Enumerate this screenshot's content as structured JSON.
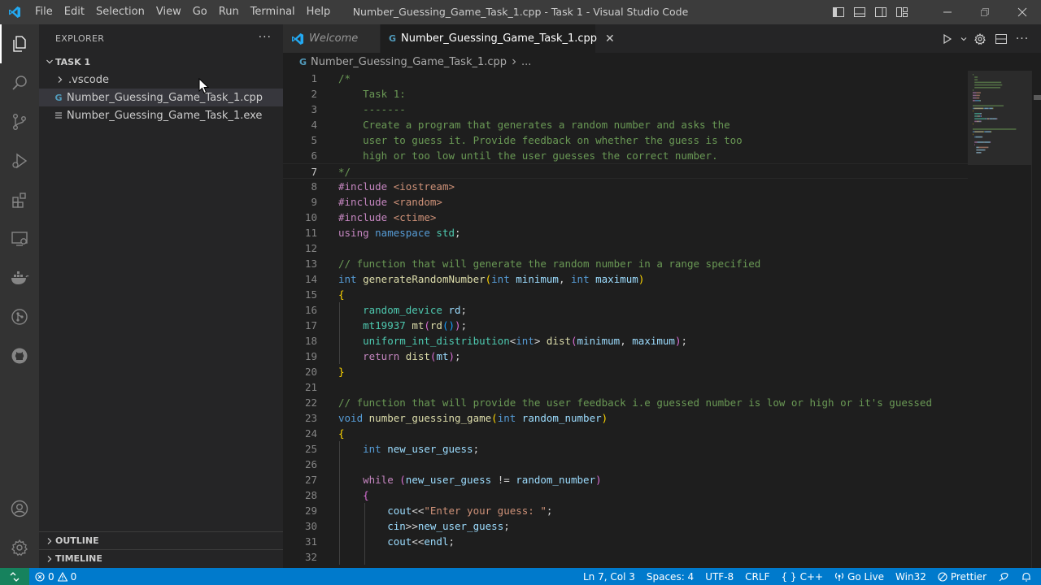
{
  "titlebar": {
    "menus": [
      "File",
      "Edit",
      "Selection",
      "View",
      "Go",
      "Run",
      "Terminal",
      "Help"
    ],
    "window_title": "Number_Guessing_Game_Task_1.cpp - Task 1 - Visual Studio Code"
  },
  "sidebar": {
    "header": "EXPLORER",
    "more": "···",
    "folder": "TASK 1",
    "items": [
      {
        "label": ".vscode",
        "kind": "folder"
      },
      {
        "label": "Number_Guessing_Game_Task_1.cpp",
        "kind": "cpp-file"
      },
      {
        "label": "Number_Guessing_Game_Task_1.exe",
        "kind": "exe-file"
      }
    ],
    "outline": "OUTLINE",
    "timeline": "TIMELINE"
  },
  "tabs": [
    {
      "label": "Welcome",
      "active": false
    },
    {
      "label": "Number_Guessing_Game_Task_1.cpp",
      "active": true
    }
  ],
  "breadcrumb": {
    "file": "Number_Guessing_Game_Task_1.cpp",
    "rest": "..."
  },
  "editor": {
    "current_line": 7,
    "lines": [
      [
        [
          "/*",
          "comment"
        ]
      ],
      [
        [
          "    Task 1:",
          "comment"
        ]
      ],
      [
        [
          "    -------",
          "comment"
        ]
      ],
      [
        [
          "    Create a program that generates a random number and asks the",
          "comment"
        ]
      ],
      [
        [
          "    user to guess it. Provide feedback on whether the guess is too",
          "comment"
        ]
      ],
      [
        [
          "    high or too low until the user guesses the correct number.",
          "comment"
        ]
      ],
      [
        [
          "*/",
          "comment"
        ]
      ],
      [
        [
          "#include ",
          "pp"
        ],
        [
          "<iostream>",
          "str"
        ]
      ],
      [
        [
          "#include ",
          "pp"
        ],
        [
          "<random>",
          "str"
        ]
      ],
      [
        [
          "#include ",
          "pp"
        ],
        [
          "<ctime>",
          "str"
        ]
      ],
      [
        [
          "using ",
          "ctrl"
        ],
        [
          "namespace ",
          "kw"
        ],
        [
          "std",
          "type"
        ],
        [
          ";",
          "plain"
        ]
      ],
      [],
      [
        [
          "// function that will generate the random number in a range specified",
          "comment"
        ]
      ],
      [
        [
          "int ",
          "kw"
        ],
        [
          "generateRandomNumber",
          "fn"
        ],
        [
          "(",
          "b1"
        ],
        [
          "int ",
          "kw"
        ],
        [
          "minimum",
          "var"
        ],
        [
          ", ",
          "plain"
        ],
        [
          "int ",
          "kw"
        ],
        [
          "maximum",
          "var"
        ],
        [
          ")",
          "b1"
        ]
      ],
      [
        [
          "{",
          "b1"
        ]
      ],
      [
        [
          "    random_device ",
          "type"
        ],
        [
          "rd",
          "var"
        ],
        [
          ";",
          "plain"
        ]
      ],
      [
        [
          "    mt19937 ",
          "type"
        ],
        [
          "mt",
          "fn"
        ],
        [
          "(",
          "b2"
        ],
        [
          "rd",
          "fn"
        ],
        [
          "()",
          "b3"
        ],
        [
          ")",
          "b2"
        ],
        [
          ";",
          "plain"
        ]
      ],
      [
        [
          "    uniform_int_distribution",
          "type"
        ],
        [
          "<",
          "plain"
        ],
        [
          "int",
          "kw"
        ],
        [
          "> ",
          "plain"
        ],
        [
          "dist",
          "fn"
        ],
        [
          "(",
          "b2"
        ],
        [
          "minimum",
          "var"
        ],
        [
          ", ",
          "plain"
        ],
        [
          "maximum",
          "var"
        ],
        [
          ")",
          "b2"
        ],
        [
          ";",
          "plain"
        ]
      ],
      [
        [
          "    return ",
          "ctrl"
        ],
        [
          "dist",
          "fn"
        ],
        [
          "(",
          "b2"
        ],
        [
          "mt",
          "var"
        ],
        [
          ")",
          "b2"
        ],
        [
          ";",
          "plain"
        ]
      ],
      [
        [
          "}",
          "b1"
        ]
      ],
      [],
      [
        [
          "// function that will provide the user feedback i.e guessed number is low or high or it's guessed",
          "comment"
        ]
      ],
      [
        [
          "void ",
          "kw"
        ],
        [
          "number_guessing_game",
          "fn"
        ],
        [
          "(",
          "b1"
        ],
        [
          "int ",
          "kw"
        ],
        [
          "random_number",
          "var"
        ],
        [
          ")",
          "b1"
        ]
      ],
      [
        [
          "{",
          "b1"
        ]
      ],
      [
        [
          "    int ",
          "kw"
        ],
        [
          "new_user_guess",
          "var"
        ],
        [
          ";",
          "plain"
        ]
      ],
      [],
      [
        [
          "    while ",
          "ctrl"
        ],
        [
          "(",
          "b2"
        ],
        [
          "new_user_guess ",
          "var"
        ],
        [
          "!= ",
          "plain"
        ],
        [
          "random_number",
          "var"
        ],
        [
          ")",
          "b2"
        ]
      ],
      [
        [
          "    {",
          "b2"
        ]
      ],
      [
        [
          "        cout",
          "var"
        ],
        [
          "<<",
          "plain"
        ],
        [
          "\"Enter your guess: \"",
          "str"
        ],
        [
          ";",
          "plain"
        ]
      ],
      [
        [
          "        cin",
          "var"
        ],
        [
          ">>",
          "plain"
        ],
        [
          "new_user_guess",
          "var"
        ],
        [
          ";",
          "plain"
        ]
      ],
      [
        [
          "        cout",
          "var"
        ],
        [
          "<<",
          "plain"
        ],
        [
          "endl",
          "var"
        ],
        [
          ";",
          "plain"
        ]
      ],
      []
    ]
  },
  "statusbar": {
    "errors": "0",
    "warnings": "0",
    "position": "Ln 7, Col 3",
    "spaces": "Spaces: 4",
    "encoding": "UTF-8",
    "eol": "CRLF",
    "language": "C++",
    "golive": "Go Live",
    "platform": "Win32",
    "prettier": "Prettier"
  },
  "colors": {
    "accent": "#007acc",
    "remote": "#16825d",
    "titlebar": "#3c3c3c",
    "activitybar": "#333333",
    "sidebar": "#252526",
    "editor": "#1e1e1e"
  }
}
